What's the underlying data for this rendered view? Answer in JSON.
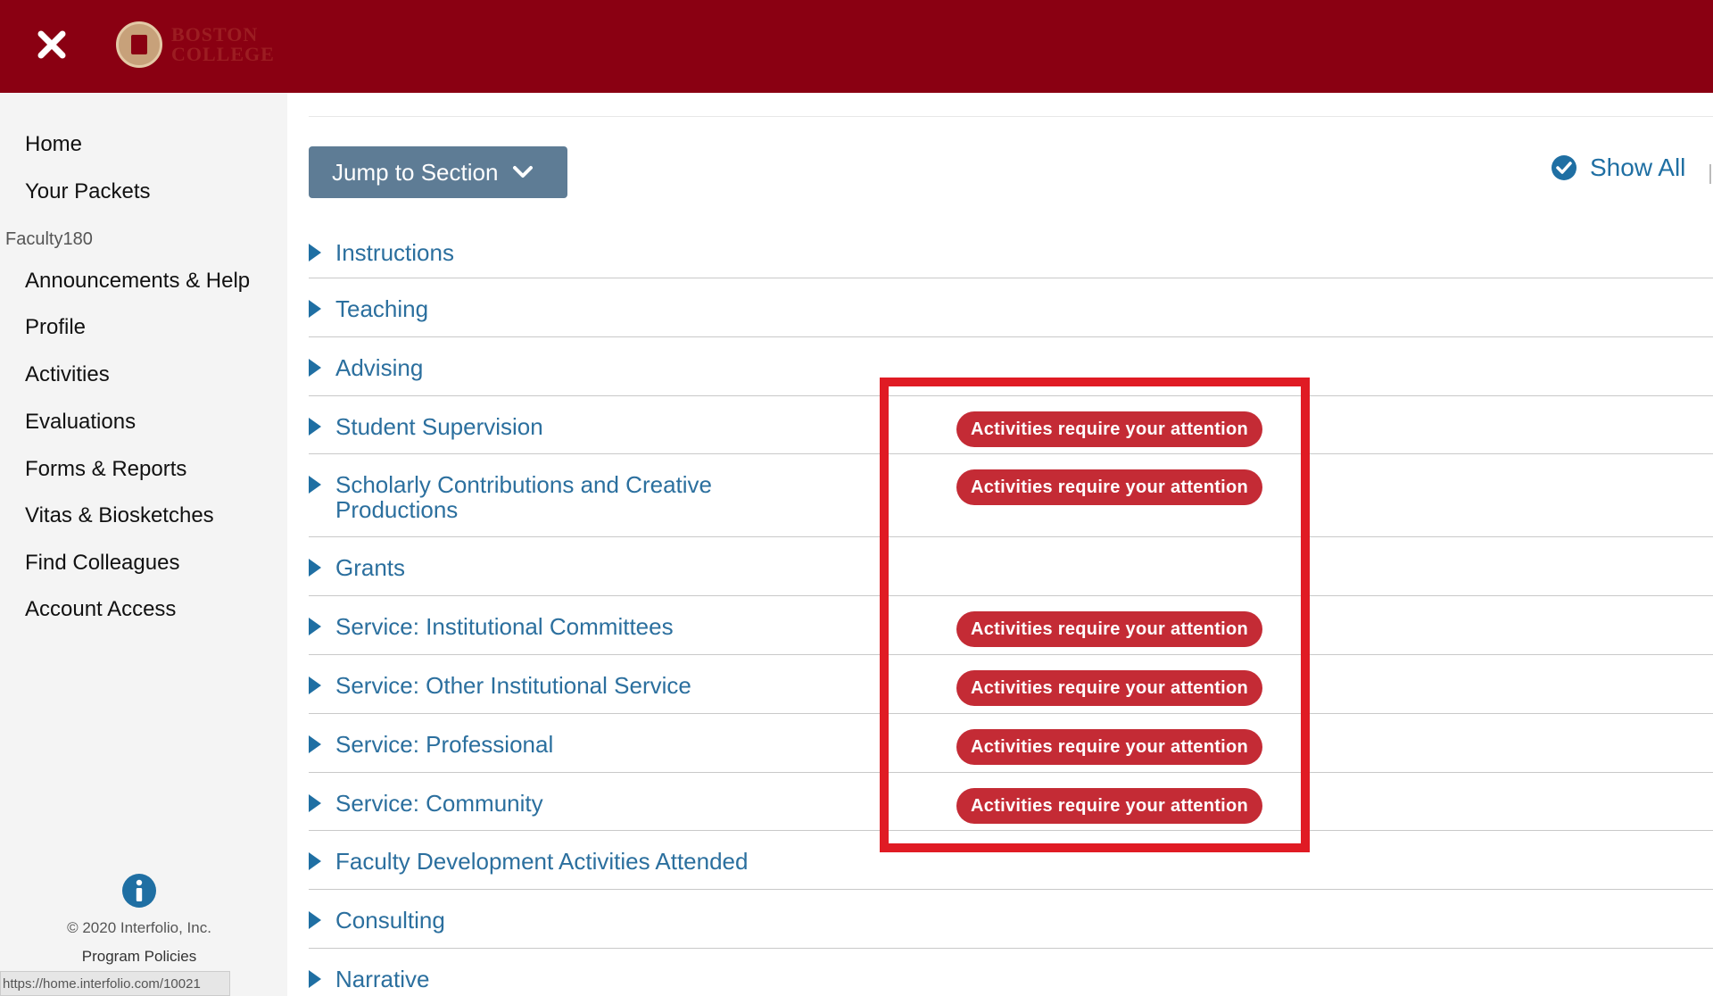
{
  "header": {
    "logo_line1": "BOSTON",
    "logo_line2": "COLLEGE"
  },
  "sidebar": {
    "items_top": [
      {
        "label": "Home"
      },
      {
        "label": "Your Packets"
      }
    ],
    "section_label": "Faculty180",
    "items": [
      {
        "label": "Announcements & Help"
      },
      {
        "label": "Profile"
      },
      {
        "label": "Activities"
      },
      {
        "label": "Evaluations"
      },
      {
        "label": "Forms & Reports"
      },
      {
        "label": "Vitas & Biosketches"
      },
      {
        "label": "Find Colleagues"
      },
      {
        "label": "Account Access"
      }
    ],
    "copyright": "© 2020 Interfolio, Inc.",
    "policies": "Program Policies",
    "status_url": "https://home.interfolio.com/10021"
  },
  "toolbar": {
    "jump_label": "Jump to Section",
    "show_all_label": "Show All"
  },
  "sections": [
    {
      "label": "Instructions",
      "badge": ""
    },
    {
      "label": "Teaching",
      "badge": ""
    },
    {
      "label": "Advising",
      "badge": ""
    },
    {
      "label": "Student Supervision",
      "badge": "Activities require your attention"
    },
    {
      "label": "Scholarly Contributions and Creative Productions",
      "badge": "Activities require your attention"
    },
    {
      "label": "Grants",
      "badge": ""
    },
    {
      "label": "Service: Institutional Committees",
      "badge": "Activities require your attention"
    },
    {
      "label": "Service: Other Institutional Service",
      "badge": "Activities require your attention"
    },
    {
      "label": "Service: Professional",
      "badge": "Activities require your attention"
    },
    {
      "label": "Service: Community",
      "badge": "Activities require your attention"
    },
    {
      "label": "Faculty Development Activities Attended",
      "badge": ""
    },
    {
      "label": "Consulting",
      "badge": ""
    },
    {
      "label": "Narrative",
      "badge": ""
    }
  ],
  "colors": {
    "brand": "#8a0012",
    "link": "#2b6f9e",
    "badge": "#c42b35",
    "highlight": "#e01b24"
  }
}
